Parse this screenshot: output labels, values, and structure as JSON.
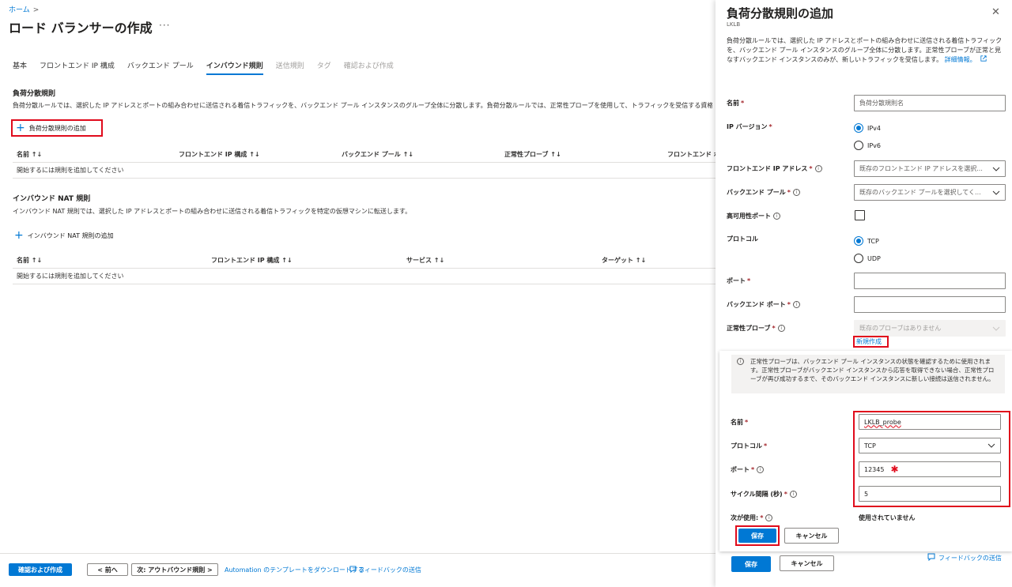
{
  "breadcrumb": {
    "home": "ホーム",
    "sep": ">"
  },
  "page": {
    "title": "ロード バランサーの作成",
    "more": "···"
  },
  "tabs": [
    {
      "label": "基本",
      "state": "normal"
    },
    {
      "label": "フロントエンド IP 構成",
      "state": "normal"
    },
    {
      "label": "バックエンド プール",
      "state": "normal"
    },
    {
      "label": "インバウンド規則",
      "state": "active"
    },
    {
      "label": "送信規則",
      "state": "disabled"
    },
    {
      "label": "タグ",
      "state": "disabled"
    },
    {
      "label": "確認および作成",
      "state": "disabled"
    }
  ],
  "lb_rules": {
    "title": "負荷分散規則",
    "desc": "負荷分散ルールでは、選択した IP アドレスとポートの組み合わせに送信される着信トラフィックを、バックエンド プール インスタンスのグループ全体に分散します。負荷分散ルールでは、正常性プローブを使用して、トラフィックを受信する資格のあるバックエンド インスタンスを特定",
    "add": "負荷分散規則の追加",
    "columns": [
      "名前 ↑↓",
      "フロントエンド IP 構成 ↑↓",
      "バックエンド プール ↑↓",
      "正常性プローブ ↑↓",
      "フロントエンド ポート"
    ],
    "empty": "開始するには規則を追加してください"
  },
  "nat_rules": {
    "title": "インバウンド NAT 規則",
    "desc": "インバウンド NAT 規則では、選択した IP アドレスとポートの組み合わせに送信される着信トラフィックを特定の仮想マシンに転送します。",
    "add": "インバウンド NAT 規則の追加",
    "columns": [
      "名前 ↑↓",
      "フロントエンド IP 構成 ↑↓",
      "サービス ↑↓",
      "ターゲット ↑↓"
    ],
    "empty": "開始するには規則を追加してください"
  },
  "footer": {
    "review": "確認および作成",
    "prev": "< 前へ",
    "next": "次: アウトバウンド規則 >",
    "download": "Automation のテンプレートをダウンロードする",
    "feedback": "フィードバックの送信"
  },
  "panel": {
    "title": "負荷分散規則の追加",
    "subtitle": "LKLB",
    "close": "✕",
    "desc": "負荷分散ルールでは、選択した IP アドレスとポートの組み合わせに送信される着信トラフィックを、バックエンド プール インスタンスのグループ全体に分散します。正常性プローブが正常と見なすバックエンド インスタンスのみが、新しいトラフィックを受信します。",
    "learn_more": "詳細情報。",
    "fields": {
      "name": {
        "label": "名前",
        "placeholder": "負荷分散規則名"
      },
      "ipver": {
        "label": "IP バージョン",
        "opt1": "IPv4",
        "opt2": "IPv6"
      },
      "frontend": {
        "label": "フロントエンド IP アドレス",
        "placeholder": "既存のフロントエンド IP アドレスを選択..."
      },
      "backend": {
        "label": "バックエンド プール",
        "placeholder": "既存のバックエンド プールを選択してく..."
      },
      "ha": {
        "label": "高可用性ポート"
      },
      "protocol": {
        "label": "プロトコル",
        "opt1": "TCP",
        "opt2": "UDP"
      },
      "port": {
        "label": "ポート"
      },
      "backend_port": {
        "label": "バックエンド ポート"
      },
      "probe": {
        "label": "正常性プローブ",
        "placeholder": "既存のプローブはありません",
        "new": "新規作成"
      }
    },
    "save": "保存",
    "cancel": "キャンセル",
    "feedback": "フィードバックの送信"
  },
  "probe_panel": {
    "info": "正常性プローブは、バックエンド プール インスタンスの状態を確認するために使用されます。正常性プローブがバックエンド インスタンスから応答を取得できない場合、正常性プローブが再び成功するまで、そのバックエンド インスタンスに新しい接続は送信されません。",
    "name_label": "名前",
    "name_value": "LKLB_probe",
    "protocol_label": "プロトコル",
    "protocol_value": "TCP",
    "port_label": "ポート",
    "port_value": "12345",
    "interval_label": "サイクル間隔 (秒)",
    "interval_value": "5",
    "usedby_label": "次が使用:",
    "usedby_value": "使用されていません",
    "save": "保存",
    "cancel": "キャンセル"
  }
}
